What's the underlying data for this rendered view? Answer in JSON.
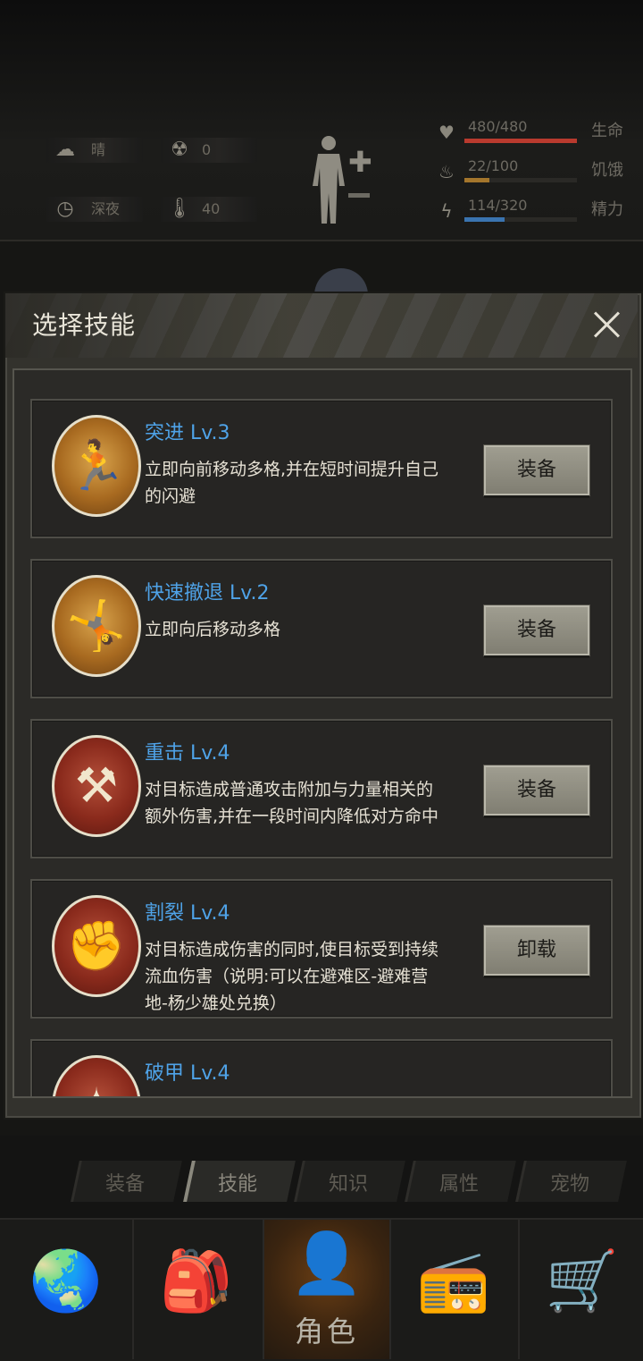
{
  "status": {
    "weather": "晴",
    "radiation": "0",
    "time_of_day": "深夜",
    "temperature": "40",
    "vitals": [
      {
        "icon": "heart-icon",
        "value": "480/480",
        "label": "生命",
        "fraction": 1.0,
        "color": "#b93a2e"
      },
      {
        "icon": "stomach-icon",
        "value": "22/100",
        "label": "饥饿",
        "fraction": 0.22,
        "color": "#a4762c"
      },
      {
        "icon": "energy-icon",
        "value": "114/320",
        "label": "精力",
        "fraction": 0.356,
        "color": "#3a74b0"
      }
    ]
  },
  "modal": {
    "title": "选择技能",
    "skills": [
      {
        "name": "突进 Lv.3",
        "desc": "立即向前移动多格,并在短时间提升自己的闪避",
        "button": "装备",
        "icon": "dash-icon",
        "tone": "gold"
      },
      {
        "name": "快速撤退 Lv.2",
        "desc": "立即向后移动多格",
        "button": "装备",
        "icon": "retreat-icon",
        "tone": "gold"
      },
      {
        "name": "重击 Lv.4",
        "desc": "对目标造成普通攻击附加与力量相关的额外伤害,并在一段时间内降低对方命中",
        "button": "装备",
        "icon": "heavy-strike-icon",
        "tone": "red"
      },
      {
        "name": "割裂 Lv.4",
        "desc": "对目标造成伤害的同时,使目标受到持续流血伤害（说明:可以在避难区-避难营地-杨少雄处兑换）",
        "button": "卸载",
        "icon": "bleed-icon",
        "tone": "red"
      },
      {
        "name": "破甲 Lv.4",
        "desc": "",
        "button": "",
        "icon": "armor-break-icon",
        "tone": "red"
      }
    ]
  },
  "tabs": [
    "装备",
    "技能",
    "知识",
    "属性",
    "宠物"
  ],
  "active_tab": "技能",
  "nav": {
    "active_label": "角色"
  }
}
